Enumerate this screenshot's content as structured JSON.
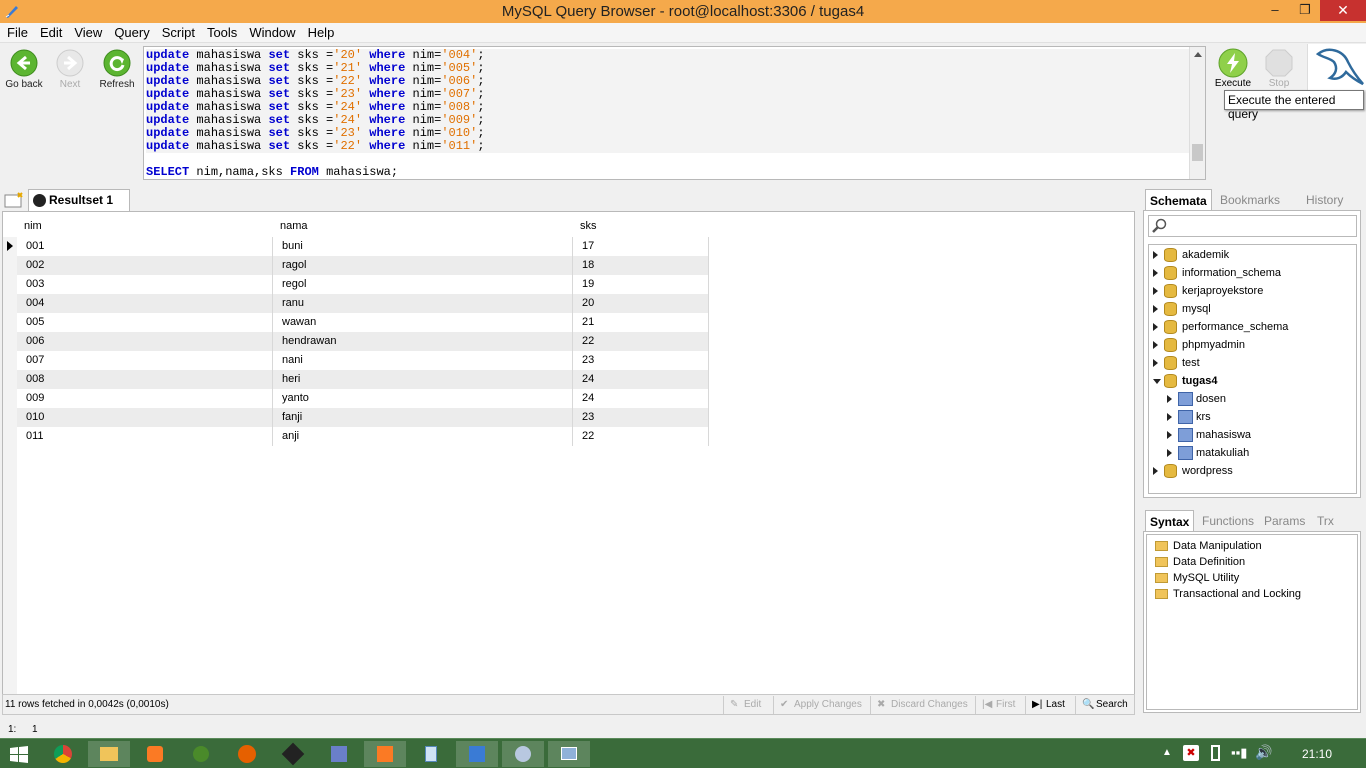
{
  "window": {
    "title": "MySQL Query Browser - root@localhost:3306 / tugas4"
  },
  "menu": [
    "File",
    "Edit",
    "View",
    "Query",
    "Script",
    "Tools",
    "Window",
    "Help"
  ],
  "toolbar": {
    "back": "Go back",
    "next": "Next",
    "refresh": "Refresh",
    "execute": "Execute",
    "stop": "Stop"
  },
  "tooltip": "Execute the entered query",
  "editor": {
    "lines": [
      {
        "val": "'20'",
        "nim": "'004'"
      },
      {
        "val": "'21'",
        "nim": "'005'"
      },
      {
        "val": "'22'",
        "nim": "'006'"
      },
      {
        "val": "'23'",
        "nim": "'007'"
      },
      {
        "val": "'24'",
        "nim": "'008'"
      },
      {
        "val": "'24'",
        "nim": "'009'"
      },
      {
        "val": "'23'",
        "nim": "'010'"
      },
      {
        "val": "'22'",
        "nim": "'011'"
      }
    ],
    "kw_update": "update",
    "table": "mahasiswa",
    "kw_set": "set",
    "col": "sks =",
    "kw_where": "where",
    "nimeq": "nim=",
    "semi": ";",
    "select_kw": "SELECT",
    "select_cols": "nim,nama,sks",
    "from_kw": "FROM",
    "select_tail": "mahasiswa;"
  },
  "resultset": {
    "tab": "Resultset 1",
    "columns": [
      "nim",
      "nama",
      "sks"
    ],
    "rows": [
      [
        "001",
        "buni",
        "17"
      ],
      [
        "002",
        "ragol",
        "18"
      ],
      [
        "003",
        "regol",
        "19"
      ],
      [
        "004",
        "ranu",
        "20"
      ],
      [
        "005",
        "wawan",
        "21"
      ],
      [
        "006",
        "hendrawan",
        "22"
      ],
      [
        "007",
        "nani",
        "23"
      ],
      [
        "008",
        "heri",
        "24"
      ],
      [
        "009",
        "yanto",
        "24"
      ],
      [
        "010",
        "fanji",
        "23"
      ],
      [
        "011",
        "anji",
        "22"
      ]
    ],
    "status": "11 rows fetched in 0,0042s (0,0010s)",
    "buttons": {
      "edit": "Edit",
      "apply": "Apply Changes",
      "discard": "Discard Changes",
      "first": "First",
      "last": "Last",
      "search": "Search"
    }
  },
  "cursor_pos": {
    "line": "1:",
    "col": "1"
  },
  "schemata": {
    "tabs": [
      "Schemata",
      "Bookmarks",
      "History"
    ],
    "dbs": [
      "akademik",
      "information_schema",
      "kerjaproyekstore",
      "mysql",
      "performance_schema",
      "phpmyadmin",
      "test",
      "tugas4"
    ],
    "tables": [
      "dosen",
      "krs",
      "mahasiswa",
      "matakuliah"
    ],
    "last_db": "wordpress"
  },
  "syntax": {
    "tabs": [
      "Syntax",
      "Functions",
      "Params",
      "Trx"
    ],
    "items": [
      "Data Manipulation",
      "Data Definition",
      "MySQL Utility",
      "Transactional and Locking"
    ]
  },
  "taskbar": {
    "time": "21:10"
  }
}
